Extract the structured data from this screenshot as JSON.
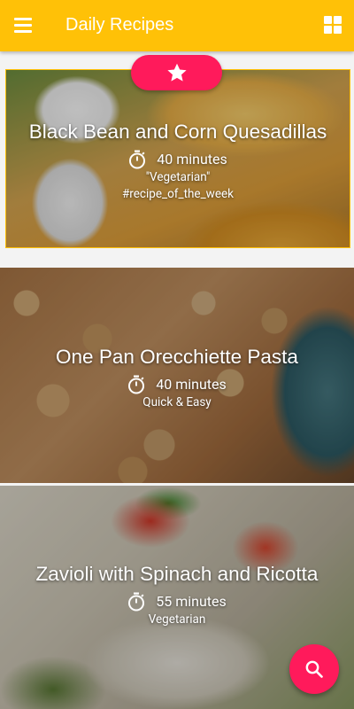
{
  "app": {
    "title": "Daily Recipes"
  },
  "colors": {
    "primary": "#ffc107",
    "accent": "#ff1a5b"
  },
  "icons": {
    "menu": "menu-icon",
    "grid": "grid-view-icon",
    "star": "star-icon",
    "timer": "timer-icon",
    "search": "search-icon"
  },
  "recipes": [
    {
      "title": "Black Bean and Corn Quesadillas",
      "time": "40 minutes",
      "category": "\"Vegetarian\"",
      "tag": "#recipe_of_the_week"
    },
    {
      "title": "One Pan Orecchiette Pasta",
      "time": "40 minutes",
      "category": "Quick & Easy"
    },
    {
      "title": "Zavioli with Spinach and Ricotta",
      "time": "55 minutes",
      "category": "Vegetarian"
    }
  ]
}
